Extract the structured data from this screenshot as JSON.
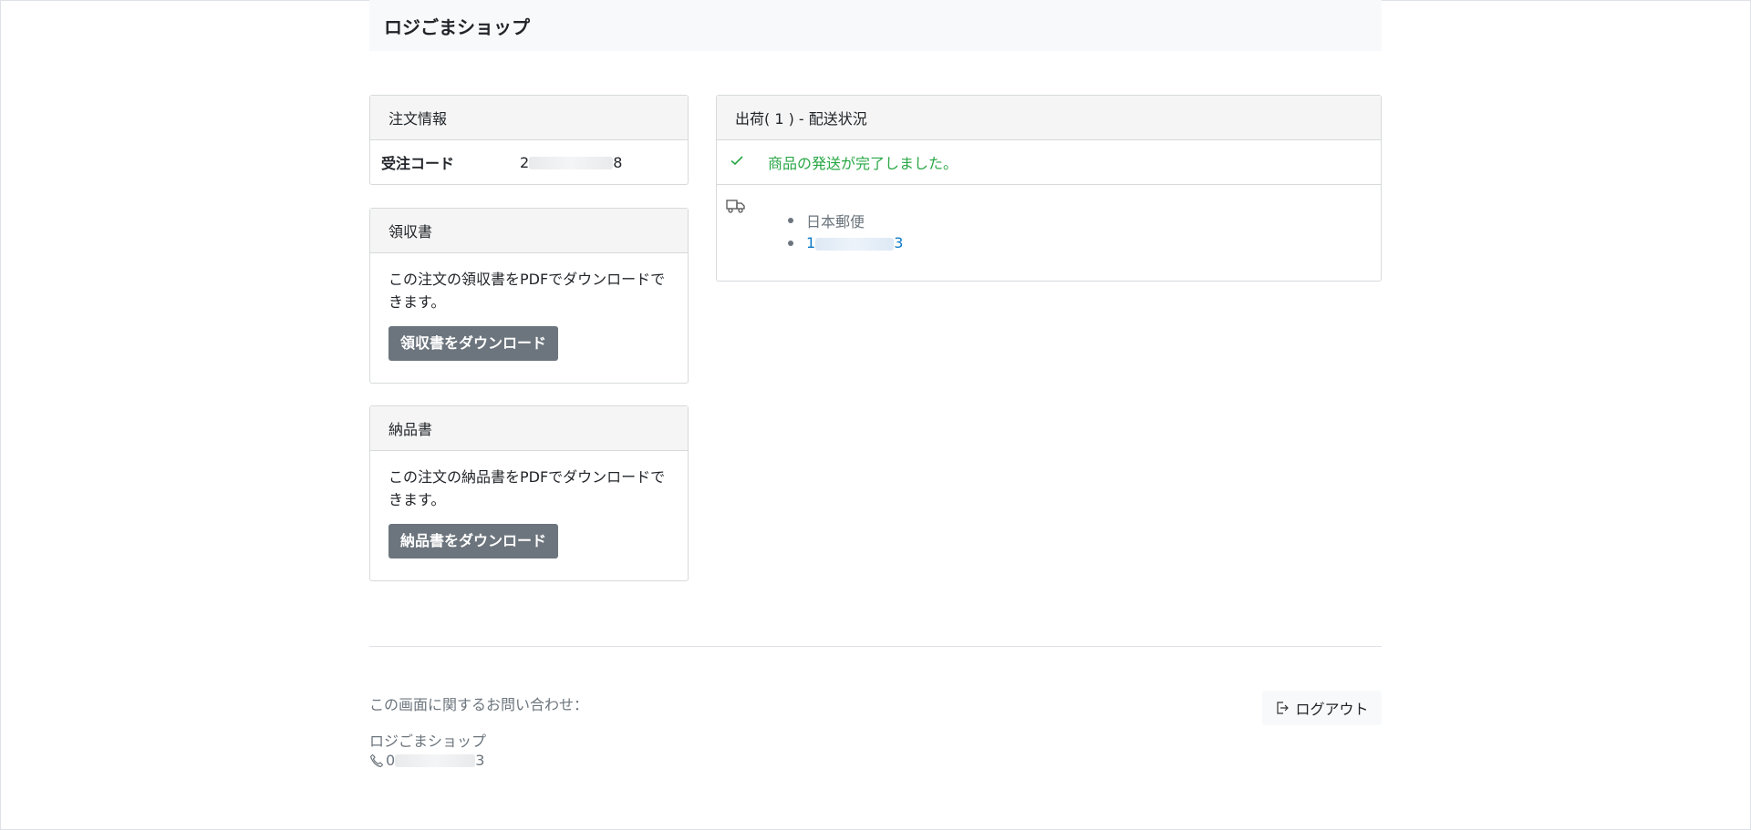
{
  "header": {
    "shop_name": "ロジごまショップ"
  },
  "order_info": {
    "title": "注文情報",
    "code_label": "受注コード",
    "code_first": "2",
    "code_last": "8"
  },
  "receipt": {
    "title": "領収書",
    "description": "この注文の領収書をPDFでダウンロードできます。",
    "button_label": "領収書をダウンロード"
  },
  "delivery_note": {
    "title": "納品書",
    "description": "この注文の納品書をPDFでダウンロードできます。",
    "button_label": "納品書をダウンロード"
  },
  "shipment": {
    "title": "出荷( 1 ) - 配送状況",
    "status_text": "商品の発送が完了しました。",
    "carrier": "日本郵便",
    "tracking_first": "1",
    "tracking_last": "3"
  },
  "footer": {
    "contact_label": "この画面に関するお問い合わせ：",
    "shop_name": "ロジごまショップ",
    "phone_first": "0",
    "phone_last": "3",
    "logout_label": "ログアウト"
  },
  "icons": {
    "check": "check-icon",
    "truck": "truck-icon",
    "phone": "phone-icon",
    "logout": "logout-icon"
  },
  "colors": {
    "success": "#28a745",
    "link": "#0d79c6",
    "button": "#6c757d",
    "header_bg": "#f8f9fa"
  }
}
